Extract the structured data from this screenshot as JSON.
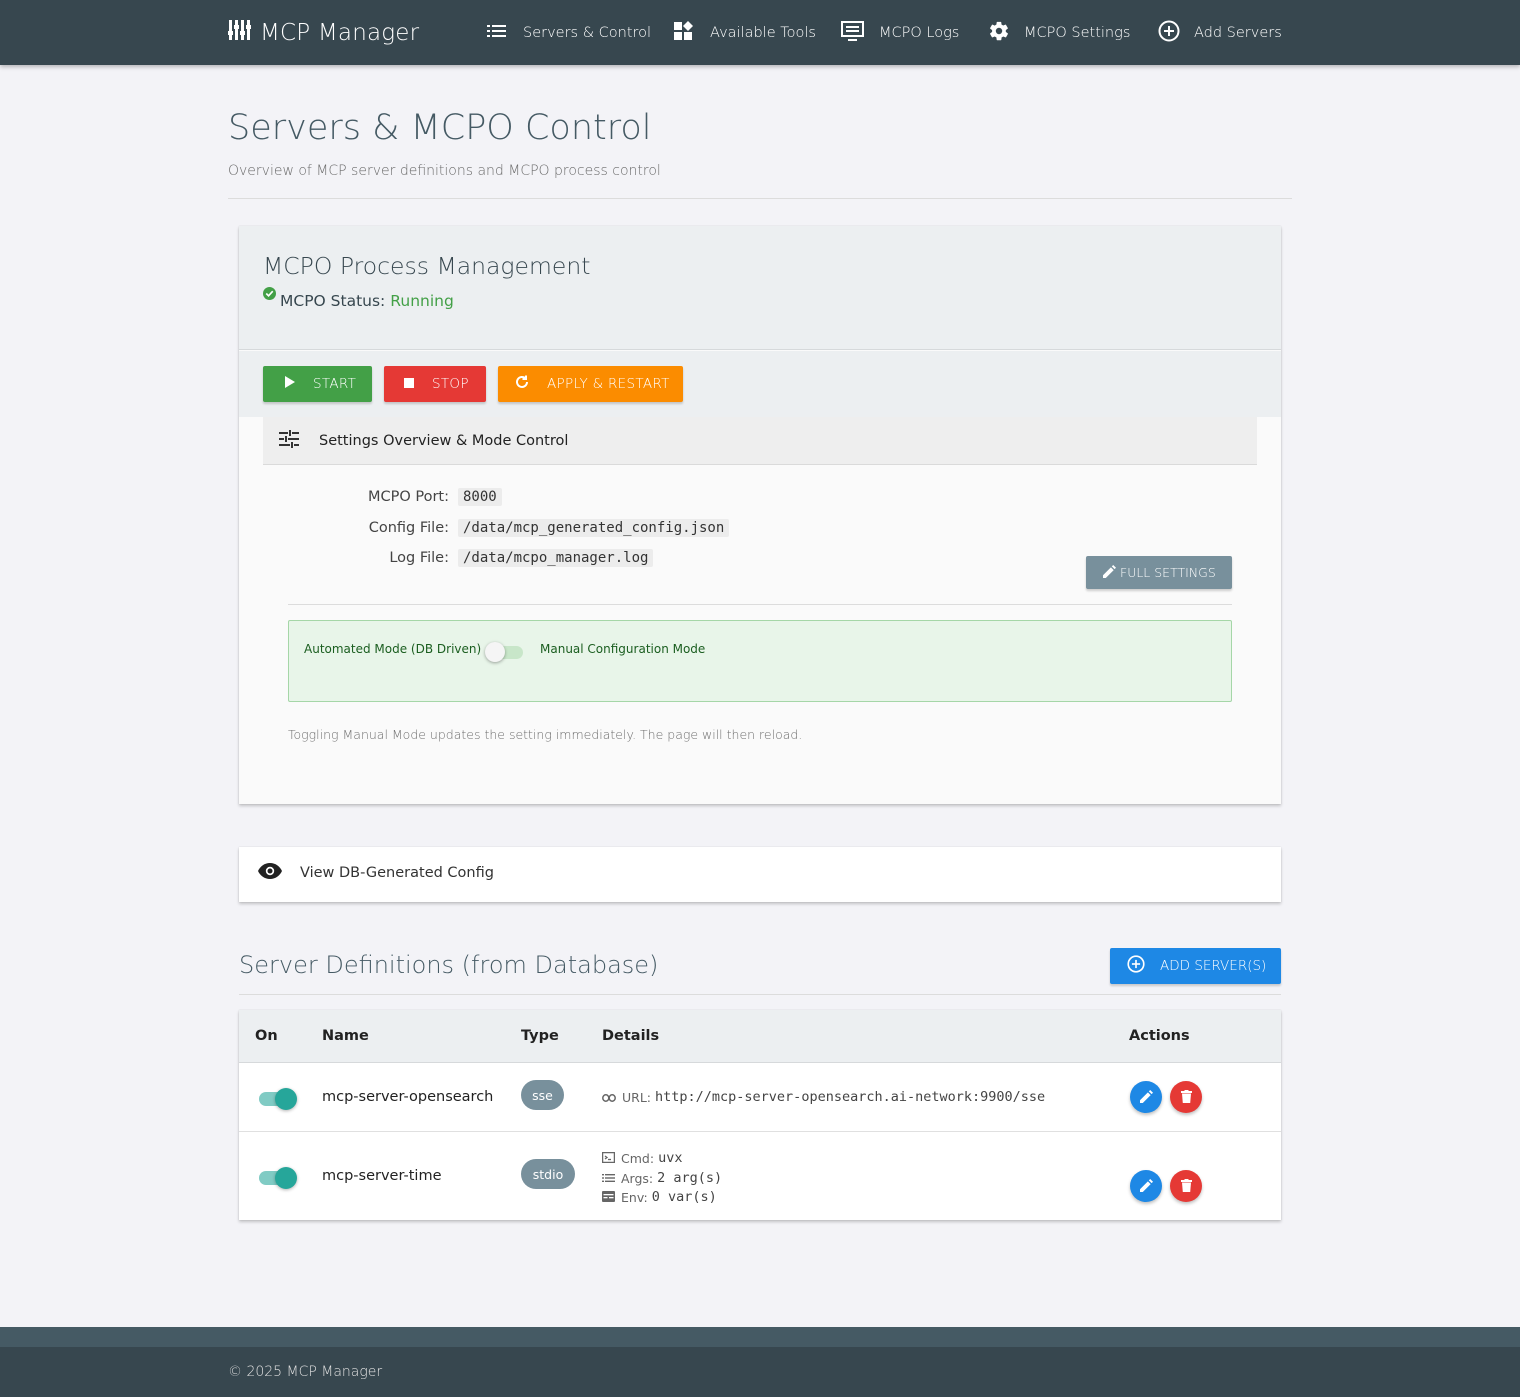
{
  "colors": {
    "navbar": "#37474f",
    "start": "#43a047",
    "stop": "#e53935",
    "apply": "#fb8c00",
    "primary": "#1e88e5",
    "secondary": "#78909c",
    "status_running": "#43a047",
    "toggle_on": "#26a69a"
  },
  "navbar": {
    "brand": "MCP Manager",
    "brand_icon": "sliders-icon",
    "items": [
      {
        "label": "Servers & Control",
        "icon": "list-icon"
      },
      {
        "label": "Available Tools",
        "icon": "widgets-icon"
      },
      {
        "label": "MCPO Logs",
        "icon": "terminal-icon"
      },
      {
        "label": "MCPO Settings",
        "icon": "gear-icon"
      },
      {
        "label": "Add Servers",
        "icon": "add-circle-icon"
      }
    ]
  },
  "header": {
    "title": "Servers & MCPO Control",
    "subtitle": "Overview of MCP server definitions and MCPO process control"
  },
  "mcpo": {
    "title": "MCPO Process Management",
    "status_label": "MCPO Status:",
    "status_value": "Running",
    "buttons": {
      "start": "Start",
      "stop": "Stop",
      "apply": "Apply & Restart"
    },
    "settings_heading": "Settings Overview & Mode Control",
    "port_label": "MCPO Port:",
    "port_value": "8000",
    "config_label": "Config File:",
    "config_value": "/data/mcp_generated_config.json",
    "log_label": "Log File:",
    "log_value": "/data/mcpo_manager.log",
    "full_settings": "Full Settings",
    "mode_left": "Automated Mode (DB Driven)",
    "mode_right": "Manual Configuration Mode",
    "manual_mode_on": false,
    "mode_note": "Toggling Manual Mode updates the setting immediately. The page will then reload."
  },
  "view_config": {
    "label": "View DB-Generated Config"
  },
  "servers": {
    "title": "Server Definitions (from Database)",
    "add_button": "Add Server(s)",
    "columns": {
      "on": "On",
      "name": "Name",
      "type": "Type",
      "details": "Details",
      "actions": "Actions"
    },
    "rows": [
      {
        "enabled": true,
        "name": "mcp-server-opensearch",
        "type": "sse",
        "url_label": "URL:",
        "url": "http://mcp-server-opensearch.ai-network:9900/sse"
      },
      {
        "enabled": true,
        "name": "mcp-server-time",
        "type": "stdio",
        "cmd_label": "Cmd:",
        "cmd": "uvx",
        "args_label": "Args:",
        "args": "2 arg(s)",
        "env_label": "Env:",
        "env": "0 var(s)"
      }
    ]
  },
  "footer": {
    "copyright": "© 2025 MCP Manager"
  }
}
